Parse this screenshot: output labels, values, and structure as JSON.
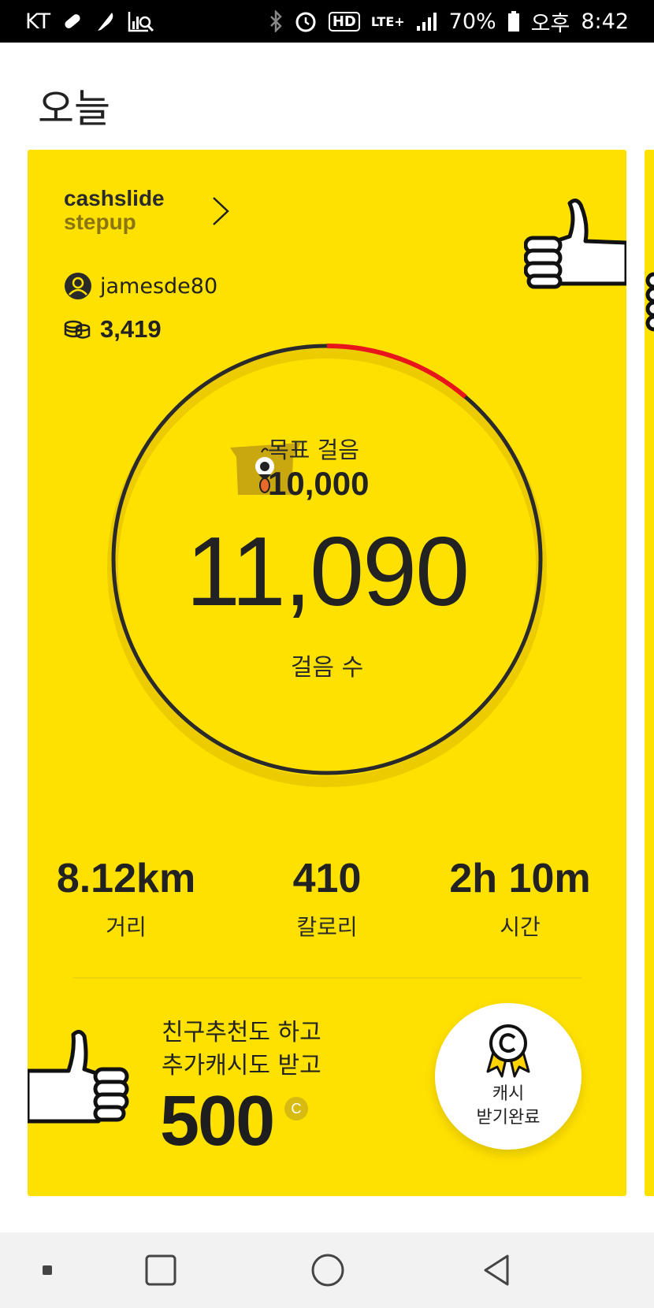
{
  "status_bar": {
    "carrier": "KT",
    "battery": "70%",
    "ampm": "오후",
    "time": "8:42",
    "icons_left": [
      "bandage-icon",
      "feather-icon",
      "chart-search-icon"
    ],
    "icons_right": [
      "bluetooth-icon",
      "alarm-icon",
      "hd-icon",
      "lte-icon",
      "signal-icon",
      "battery-icon"
    ],
    "hd": "HD",
    "lte": "LTE+"
  },
  "page": {
    "title": "오늘"
  },
  "card": {
    "brand_line1": "cashslide",
    "brand_line2": "stepup",
    "username": "jamesde80",
    "coins": "3,419",
    "goal_label": "목표 걸음",
    "goal_value": "10,000",
    "steps_value": "11,090",
    "steps_label": "걸음 수",
    "goal_progress": 1.109,
    "stats": [
      {
        "value": "8.12km",
        "label": "거리"
      },
      {
        "value": "410",
        "label": "칼로리"
      },
      {
        "value": "2h 10m",
        "label": "시간"
      }
    ],
    "promo_line1": "친구추천도 하고",
    "promo_line2": "추가캐시도 받고",
    "promo_amount": "500",
    "cash_symbol": "C",
    "receive_line1": "캐시",
    "receive_line2": "받기완료"
  },
  "colors": {
    "card": "#ffe100",
    "ring": "#2a2a2a",
    "progress_over": "#e8151b",
    "accent_brand": "#8a7510"
  },
  "nav": [
    "recent-apps-dot-icon",
    "overview-square-icon",
    "home-circle-icon",
    "back-triangle-icon"
  ]
}
